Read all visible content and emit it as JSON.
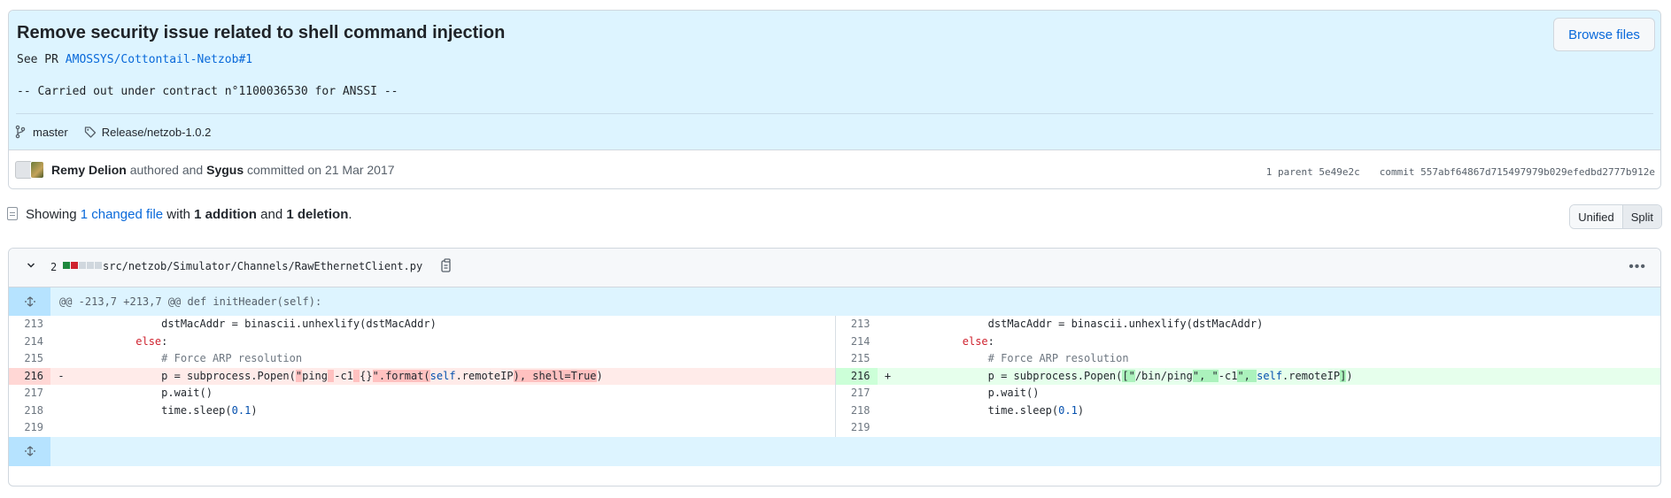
{
  "commit": {
    "title": "Remove security issue related to shell command injection",
    "pr_prefix": "See PR ",
    "pr_link": "AMOSSYS/Cottontail-Netzob#1",
    "contract": "-- Carried out under contract n°1100036530 for ANSSI --",
    "browse_files": "Browse files",
    "branch": "master",
    "tag": "Release/netzob-1.0.2",
    "author": "Remy Delion",
    "authored_text": " authored and ",
    "committer": "Sygus",
    "committed_text": " committed on 21 Mar 2017",
    "parent": "1 parent 5e49e2c",
    "sha": "commit 557abf64867d715497979b029efedbd2777b912e"
  },
  "toolbar": {
    "showing": "Showing ",
    "changed_files": "1 changed file",
    "with": " with ",
    "additions": "1 addition",
    "and": " and ",
    "deletions": "1 deletion",
    "period": ".",
    "unified": "Unified",
    "split": "Split"
  },
  "file": {
    "changes": "2",
    "path": "src/netzob/Simulator/Channels/RawEthernetClient.py",
    "hunk_header": "@@ -213,7 +213,7 @@ def initHeader(self):",
    "diffstat_colors": [
      "#1f883d",
      "#cf222e",
      "#d0d7de",
      "#d0d7de",
      "#d0d7de"
    ]
  },
  "lines": {
    "l213": "213",
    "l214": "214",
    "l215": "215",
    "l216": "216",
    "l217": "217",
    "l218": "218",
    "l219": "219",
    "minus": "-",
    "plus": "+"
  },
  "icons": {
    "branch": "git-branch-icon",
    "tag": "tag-icon",
    "file": "file-diff-icon",
    "chevron": "chevron-down-icon",
    "copy": "copy-icon",
    "kebab": "kebab-horizontal-icon",
    "expand": "unfold-icon"
  }
}
